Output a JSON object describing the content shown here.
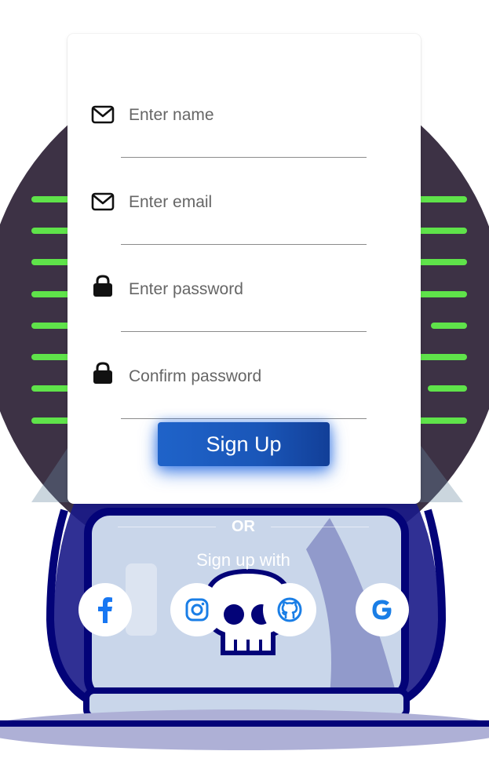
{
  "form": {
    "fields": [
      {
        "placeholder": "Enter name",
        "icon": "envelope-icon"
      },
      {
        "placeholder": "Enter email",
        "icon": "envelope-icon"
      },
      {
        "placeholder": "Enter password",
        "icon": "lock-icon"
      },
      {
        "placeholder": "Confirm password",
        "icon": "lock-icon"
      }
    ],
    "submit_label": "Sign Up"
  },
  "divider": {
    "text": "OR"
  },
  "social": {
    "heading": "Sign up with",
    "providers": [
      {
        "name": "Facebook",
        "icon": "facebook-icon",
        "color": "#1877f2"
      },
      {
        "name": "Instagram",
        "icon": "instagram-icon",
        "color": "#1a7ee6"
      },
      {
        "name": "GitHub",
        "icon": "github-icon",
        "color": "#1a7ee6"
      },
      {
        "name": "Google",
        "icon": "google-icon",
        "color": "#1a7ee6"
      }
    ]
  },
  "theme": {
    "accent": "#1f63c9",
    "background_circle": "#3d3245",
    "equalizer_bars": "#5fe34a",
    "robot_outline": "#030378"
  }
}
